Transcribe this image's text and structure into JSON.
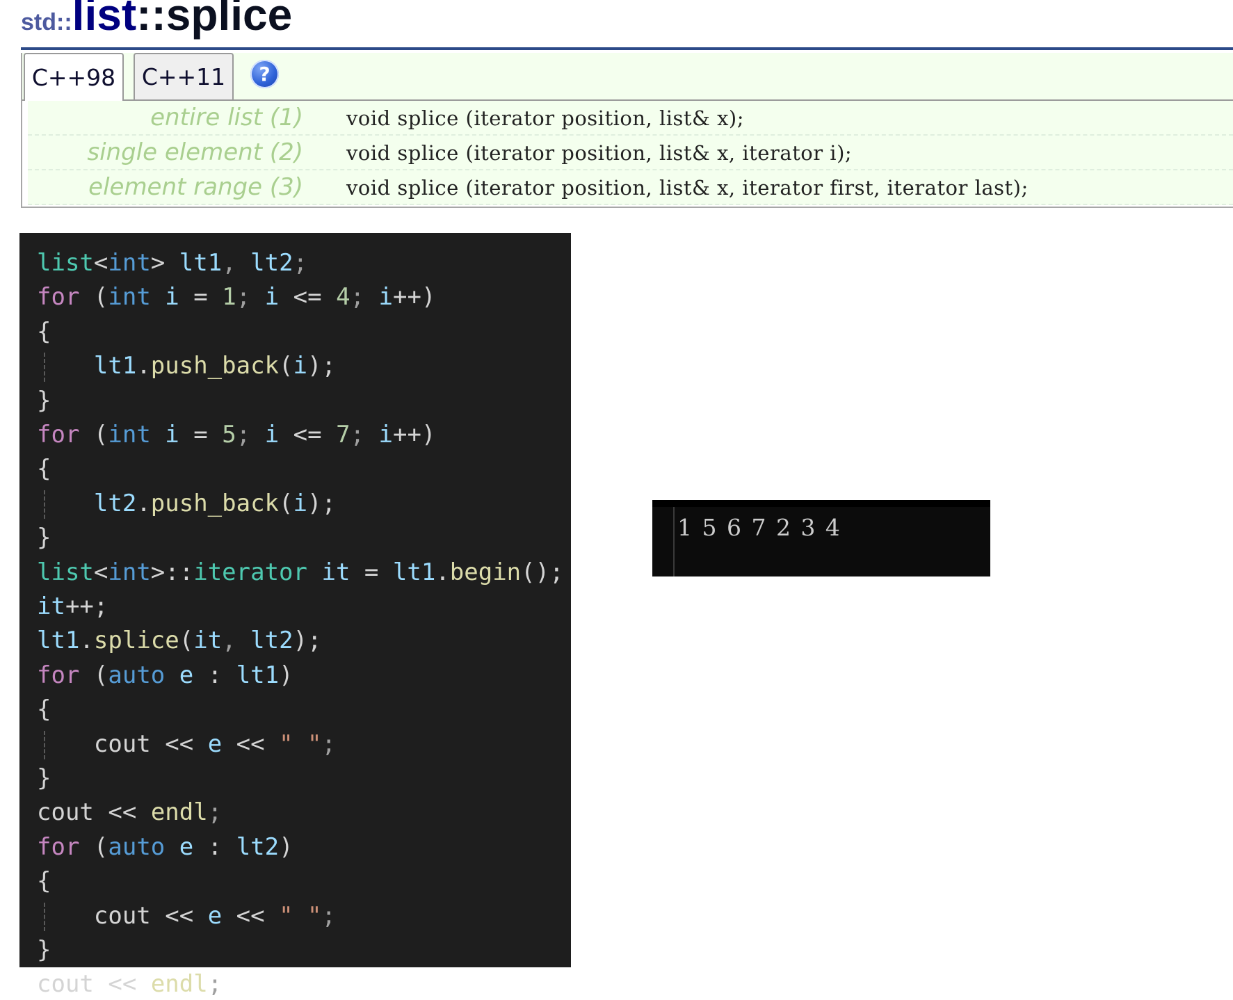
{
  "header": {
    "namespace": "std::",
    "class_name": "list",
    "member": "::splice"
  },
  "tabs": [
    {
      "label": "C++98"
    },
    {
      "label": "C++11"
    }
  ],
  "help_icon": {
    "glyph": "?",
    "icon": "help-icon"
  },
  "prototypes": [
    {
      "label": "entire list (1)",
      "code": "void splice (iterator position, list& x);"
    },
    {
      "label": "single element (2)",
      "code": "void splice (iterator position, list& x, iterator i);"
    },
    {
      "label": "element range (3)",
      "code": "void splice (iterator position, list& x, iterator first, iterator last);"
    }
  ],
  "code": {
    "lines": [
      "list<int> lt1, lt2;",
      "for (int i = 1; i <= 4; i++)",
      "{",
      "    lt1.push_back(i);",
      "}",
      "for (int i = 5; i <= 7; i++)",
      "{",
      "    lt2.push_back(i);",
      "}",
      "list<int>::iterator it = lt1.begin();",
      "it++;",
      "lt1.splice(it, lt2);",
      "for (auto e : lt1)",
      "{",
      "    cout << e << \" \";",
      "}",
      "cout << endl;",
      "for (auto e : lt2)",
      "{",
      "    cout << e << \" \";",
      "}",
      "cout << endl;"
    ]
  },
  "console": {
    "output": "1 5 6 7 2 3 4"
  },
  "colors": {
    "title_class": "#000080",
    "title_namespace": "#4d5a9f",
    "title_rule": "#2c4a88",
    "proto_bg": "#f4ffee",
    "proto_label": "#a9cf8f",
    "editor_bg": "#1e1e1e",
    "console_bg": "#0c0c0c"
  }
}
